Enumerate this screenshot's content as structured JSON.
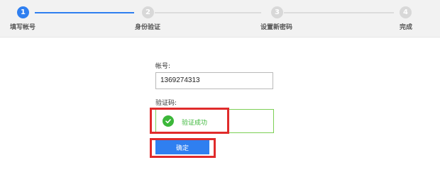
{
  "steps": [
    {
      "number": "1",
      "label": "填写帐号",
      "active": true
    },
    {
      "number": "2",
      "label": "身份验证",
      "active": false
    },
    {
      "number": "3",
      "label": "设置新密码",
      "active": false
    },
    {
      "number": "4",
      "label": "完成",
      "active": false
    }
  ],
  "form": {
    "account_label": "帐号:",
    "account_value": "1369274313",
    "captcha_label": "验证码:",
    "captcha_status": "验证成功",
    "confirm_label": "确定"
  },
  "colors": {
    "accent": "#2f7ff0",
    "success": "#3cb73a",
    "annotation": "#e02b2b"
  },
  "icons": {
    "captcha_status_icon": "check-circle-icon"
  }
}
